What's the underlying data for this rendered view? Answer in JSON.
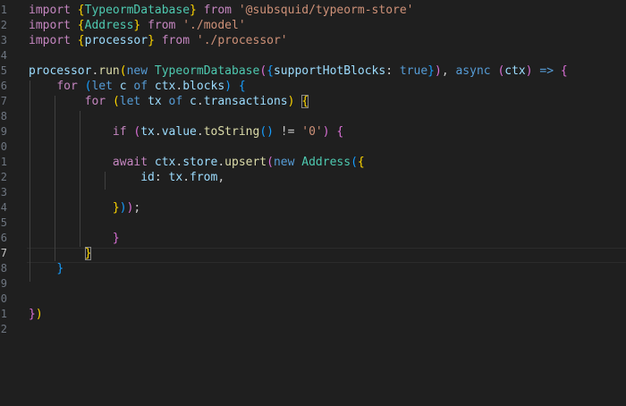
{
  "editor": {
    "gutter": [
      "1",
      "2",
      "3",
      "4",
      "5",
      "6",
      "7",
      "8",
      "9",
      "0",
      "1",
      "2",
      "3",
      "4",
      "5",
      "6",
      "7",
      "8",
      "9",
      "0",
      "1",
      "2"
    ],
    "active_line_number": "7",
    "lines": [
      [
        [
          "kw",
          "import "
        ],
        [
          "b1",
          "{"
        ],
        [
          "cls",
          "TypeormDatabase"
        ],
        [
          "b1",
          "}"
        ],
        [
          "kw",
          " from "
        ],
        [
          "str",
          "'@subsquid/typeorm-store'"
        ]
      ],
      [
        [
          "kw",
          "import "
        ],
        [
          "b1",
          "{"
        ],
        [
          "cls",
          "Address"
        ],
        [
          "b1",
          "}"
        ],
        [
          "kw",
          " from "
        ],
        [
          "str",
          "'./model'"
        ]
      ],
      [
        [
          "kw",
          "import "
        ],
        [
          "b1",
          "{"
        ],
        [
          "var",
          "processor"
        ],
        [
          "b1",
          "}"
        ],
        [
          "kw",
          " from "
        ],
        [
          "str",
          "'./processor'"
        ]
      ],
      [],
      [
        [
          "var",
          "processor"
        ],
        [
          "pun",
          "."
        ],
        [
          "fn",
          "run"
        ],
        [
          "b1",
          "("
        ],
        [
          "kwb",
          "new "
        ],
        [
          "cls",
          "TypeormDatabase"
        ],
        [
          "b2",
          "("
        ],
        [
          "b3",
          "{"
        ],
        [
          "var",
          "supportHotBlocks"
        ],
        [
          "pun",
          ": "
        ],
        [
          "kwb",
          "true"
        ],
        [
          "b3",
          "}"
        ],
        [
          "b2",
          ")"
        ],
        [
          "pun",
          ", "
        ],
        [
          "kwb",
          "async "
        ],
        [
          "b2",
          "("
        ],
        [
          "var",
          "ctx"
        ],
        [
          "b2",
          ")"
        ],
        [
          "kwb",
          " => "
        ],
        [
          "b2",
          "{"
        ]
      ],
      [
        [
          "pun",
          "    "
        ],
        [
          "kw",
          "for "
        ],
        [
          "b3",
          "("
        ],
        [
          "kwb",
          "let "
        ],
        [
          "var",
          "c"
        ],
        [
          "kwb",
          " of "
        ],
        [
          "var",
          "ctx"
        ],
        [
          "pun",
          "."
        ],
        [
          "var",
          "blocks"
        ],
        [
          "b3",
          ")"
        ],
        [
          "pun",
          " "
        ],
        [
          "b3",
          "{"
        ]
      ],
      [
        [
          "pun",
          "        "
        ],
        [
          "kw",
          "for "
        ],
        [
          "b1",
          "("
        ],
        [
          "kwb",
          "let "
        ],
        [
          "var",
          "tx"
        ],
        [
          "kwb",
          " of "
        ],
        [
          "var",
          "c"
        ],
        [
          "pun",
          "."
        ],
        [
          "var",
          "transactions"
        ],
        [
          "b1",
          ")"
        ],
        [
          "pun",
          " "
        ],
        [
          "b1",
          "{"
        ]
      ],
      [],
      [
        [
          "pun",
          "            "
        ],
        [
          "kw",
          "if "
        ],
        [
          "b2",
          "("
        ],
        [
          "var",
          "tx"
        ],
        [
          "pun",
          "."
        ],
        [
          "var",
          "value"
        ],
        [
          "pun",
          "."
        ],
        [
          "fn",
          "toString"
        ],
        [
          "b3",
          "()"
        ],
        [
          "pun",
          " != "
        ],
        [
          "str",
          "'0'"
        ],
        [
          "b2",
          ")"
        ],
        [
          "pun",
          " "
        ],
        [
          "b2",
          "{"
        ]
      ],
      [],
      [
        [
          "pun",
          "            "
        ],
        [
          "kw",
          "await "
        ],
        [
          "var",
          "ctx"
        ],
        [
          "pun",
          "."
        ],
        [
          "var",
          "store"
        ],
        [
          "pun",
          "."
        ],
        [
          "fn",
          "upsert"
        ],
        [
          "b2",
          "("
        ],
        [
          "kwb",
          "new "
        ],
        [
          "cls",
          "Address"
        ],
        [
          "b3",
          "("
        ],
        [
          "b1",
          "{"
        ]
      ],
      [
        [
          "pun",
          "                "
        ],
        [
          "var",
          "id"
        ],
        [
          "pun",
          ": "
        ],
        [
          "var",
          "tx"
        ],
        [
          "pun",
          "."
        ],
        [
          "var",
          "from"
        ],
        [
          "pun",
          ","
        ]
      ],
      [],
      [
        [
          "pun",
          "            "
        ],
        [
          "b1",
          "}"
        ],
        [
          "b3",
          ")"
        ],
        [
          "b2",
          ")"
        ],
        [
          "pun",
          ";"
        ]
      ],
      [],
      [
        [
          "pun",
          "            "
        ],
        [
          "b2",
          "}"
        ]
      ],
      [
        [
          "pun",
          "        "
        ],
        [
          "b1",
          "}"
        ]
      ],
      [
        [
          "pun",
          "    "
        ],
        [
          "b3",
          "}"
        ]
      ],
      [],
      [],
      [
        [
          "b2",
          "}"
        ],
        [
          "b1",
          ")"
        ]
      ],
      []
    ]
  }
}
